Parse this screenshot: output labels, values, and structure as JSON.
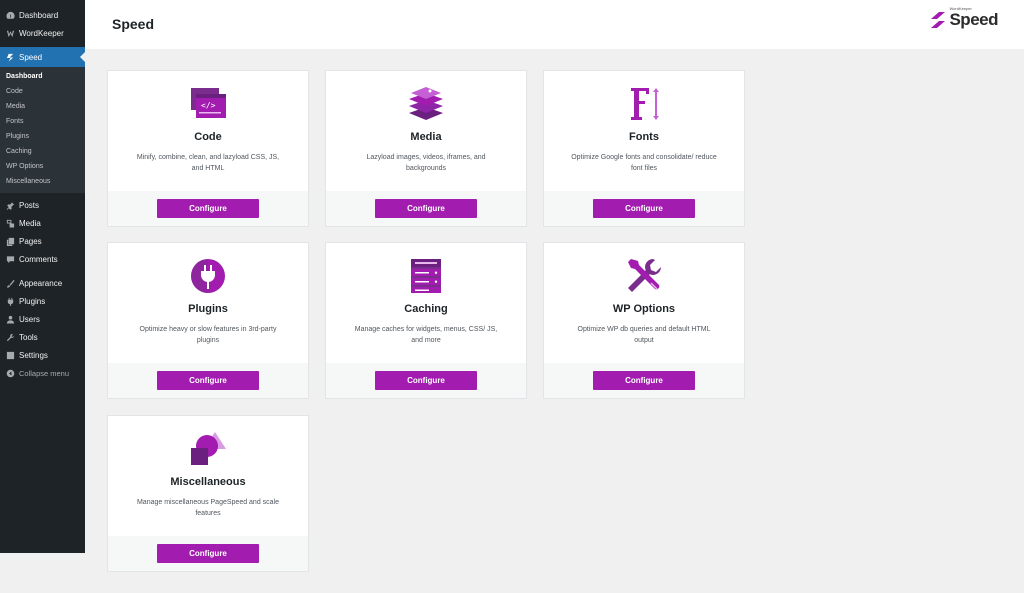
{
  "sidebar": {
    "top_items": [
      {
        "label": "Dashboard",
        "icon": "dashboard-icon"
      },
      {
        "label": "WordKeeper",
        "icon": "wordkeeper-icon"
      }
    ],
    "active_item": {
      "label": "Speed",
      "icon": "speed-icon"
    },
    "submenu": [
      "Dashboard",
      "Code",
      "Media",
      "Fonts",
      "Plugins",
      "Caching",
      "WP Options",
      "Miscellaneous"
    ],
    "bottom_items_a": [
      {
        "label": "Posts",
        "icon": "pin-icon"
      },
      {
        "label": "Media",
        "icon": "media-icon"
      },
      {
        "label": "Pages",
        "icon": "pages-icon"
      },
      {
        "label": "Comments",
        "icon": "comments-icon"
      }
    ],
    "bottom_items_b": [
      {
        "label": "Appearance",
        "icon": "appearance-icon"
      },
      {
        "label": "Plugins",
        "icon": "plugins-icon"
      },
      {
        "label": "Users",
        "icon": "users-icon"
      },
      {
        "label": "Tools",
        "icon": "tools-icon"
      },
      {
        "label": "Settings",
        "icon": "settings-icon"
      }
    ],
    "collapse_label": "Collapse menu"
  },
  "header": {
    "title": "Speed",
    "brand_small": "WordKeeper",
    "brand_name": "Speed"
  },
  "accent_color": "#a21caf",
  "cards": [
    {
      "title": "Code",
      "desc": "Minify, combine, clean, and lazyload CSS, JS, and HTML",
      "button": "Configure",
      "icon": "code-icon"
    },
    {
      "title": "Media",
      "desc": "Lazyload images, videos, iframes, and backgrounds",
      "button": "Configure",
      "icon": "media-layers-icon"
    },
    {
      "title": "Fonts",
      "desc": "Optimize Google fonts and consolidate/ reduce font files",
      "button": "Configure",
      "icon": "fonts-icon"
    },
    {
      "title": "Plugins",
      "desc": "Optimize heavy or slow features in 3rd-party plugins",
      "button": "Configure",
      "icon": "plug-icon"
    },
    {
      "title": "Caching",
      "desc": "Manage caches for widgets, menus, CSS/ JS, and more",
      "button": "Configure",
      "icon": "server-icon"
    },
    {
      "title": "WP Options",
      "desc": "Optimize WP db queries and default HTML output",
      "button": "Configure",
      "icon": "tools-cross-icon"
    },
    {
      "title": "Miscellaneous",
      "desc": "Manage miscellaneous PageSpeed and scale features",
      "button": "Configure",
      "icon": "shapes-icon"
    }
  ]
}
